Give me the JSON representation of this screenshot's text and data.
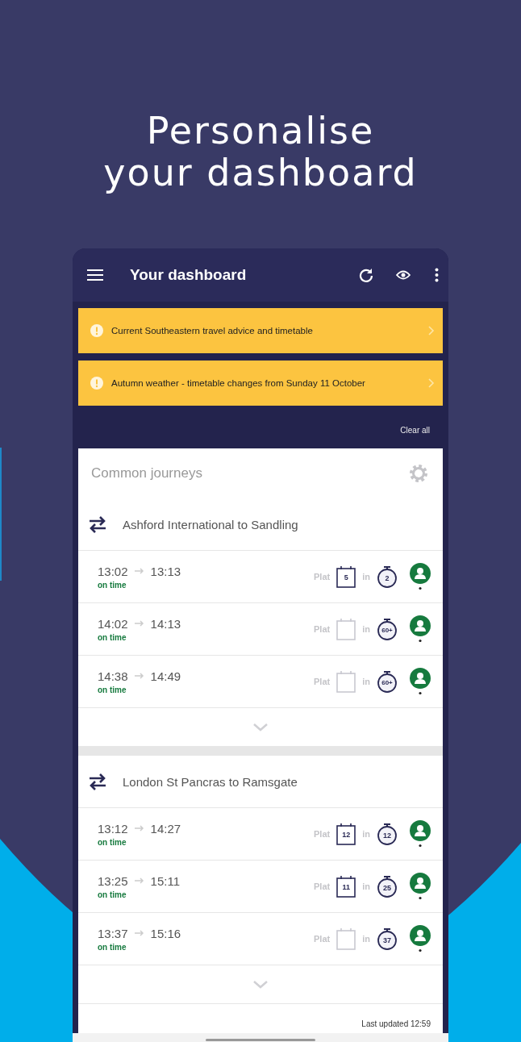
{
  "headline": [
    "Personalise",
    "your dashboard"
  ],
  "app_bar": {
    "title": "Your dashboard"
  },
  "alerts": [
    {
      "text": "Current Southeastern travel advice and timetable"
    },
    {
      "text": "Autumn weather - timetable changes from Sunday 11 October"
    }
  ],
  "clear_all": "Clear all",
  "section_title": "Common journeys",
  "journeys": [
    {
      "route": "Ashford International to Sandling",
      "services": [
        {
          "depart": "13:02",
          "arrive": "13:13",
          "status": "on time",
          "plat_label": "Plat",
          "platform": "5",
          "in_label": "in",
          "minutes": "2"
        },
        {
          "depart": "14:02",
          "arrive": "14:13",
          "status": "on time",
          "plat_label": "Plat",
          "in_label": "in",
          "minutes": "60+"
        },
        {
          "depart": "14:38",
          "arrive": "14:49",
          "status": "on time",
          "plat_label": "Plat",
          "in_label": "in",
          "minutes": "60+"
        }
      ]
    },
    {
      "route": "London St Pancras to Ramsgate",
      "services": [
        {
          "depart": "13:12",
          "arrive": "14:27",
          "status": "on time",
          "plat_label": "Plat",
          "platform": "12",
          "in_label": "in",
          "minutes": "12"
        },
        {
          "depart": "13:25",
          "arrive": "15:11",
          "status": "on time",
          "plat_label": "Plat",
          "platform": "11",
          "in_label": "in",
          "minutes": "25"
        },
        {
          "depart": "13:37",
          "arrive": "15:16",
          "status": "on time",
          "plat_label": "Plat",
          "in_label": "in",
          "minutes": "37"
        }
      ]
    }
  ],
  "last_updated": "Last updated 12:59"
}
